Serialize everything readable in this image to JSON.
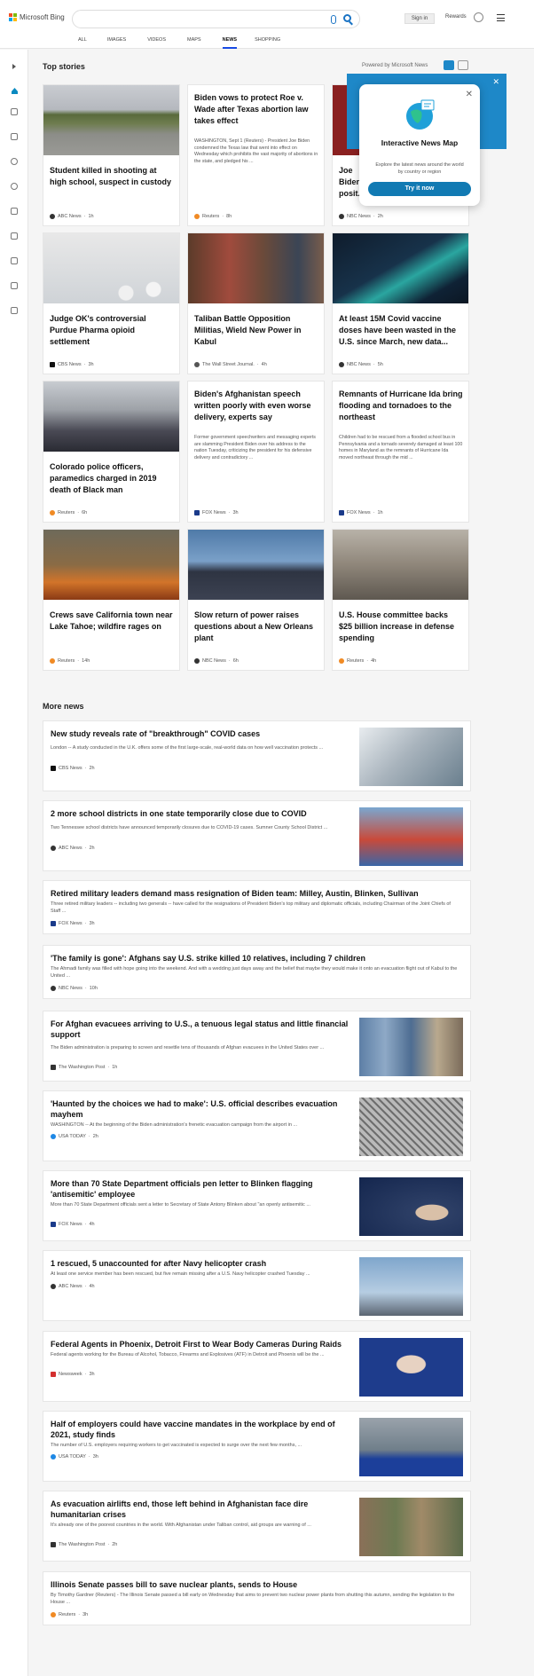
{
  "header": {
    "logo_text": "Microsoft Bing",
    "signin_label": "Sign in",
    "rewards_label": "Rewards"
  },
  "nav": {
    "tabs": [
      {
        "label": "ALL"
      },
      {
        "label": "IMAGES"
      },
      {
        "label": "VIDEOS"
      },
      {
        "label": "MAPS"
      },
      {
        "label": "NEWS"
      },
      {
        "label": "SHOPPING"
      }
    ]
  },
  "top_stories": {
    "title": "Top stories",
    "powered_by": "Powered by Microsoft News",
    "cards": [
      {
        "title": "Student killed in shooting at high school, suspect in custody",
        "source": "ABC News",
        "time": "1h",
        "src_color": "#333"
      },
      {
        "title": "Biden vows to protect Roe v. Wade after Texas abortion law takes effect",
        "snippet": "WASHINGTON, Sept 1 (Reuters) - President Joe Biden condemned the Texas law that went into effect on Wednesday which prohibits the vast majority of abortions in the state, and pledged his ...",
        "source": "Reuters",
        "time": "8h",
        "src_color": "#f08a24"
      },
      {
        "title": "Joe Biden ... posit... ivern...",
        "source": "NBC News",
        "time": "2h",
        "src_color": "#333"
      },
      {
        "title": "Judge OK's controversial Purdue Pharma opioid settlement",
        "source": "CBS News",
        "time": "3h",
        "src_color": "#111"
      },
      {
        "title": "Taliban Battle Opposition Militias, Wield New Power in Kabul",
        "source": "The Wall Street Journal.",
        "time": "4h",
        "src_color": "#555"
      },
      {
        "title": "At least 15M Covid vaccine doses have been wasted in the U.S. since March, new data...",
        "source": "NBC News",
        "time": "5h",
        "src_color": "#333"
      },
      {
        "title": "Colorado police officers, paramedics charged in 2019 death of Black man",
        "source": "Reuters",
        "time": "6h",
        "src_color": "#f08a24"
      },
      {
        "title": "Biden's Afghanistan speech written poorly with even worse delivery, experts say",
        "snippet": "Former government speechwriters and messaging experts are slamming President Biden over his address to the nation Tuesday, criticizing the president for his defensive delivery and contradictory ...",
        "source": "FOX News",
        "time": "3h",
        "src_color": "#1a3a8a"
      },
      {
        "title": "Remnants of Hurricane Ida bring flooding and tornadoes to the northeast",
        "snippet": "Children had to be rescued from a flooded school bus in Pennsylvania and a tornado severely damaged at least 100 homes in Maryland as the remnants of Hurricane Ida moved northeast through the mid ...",
        "source": "FOX News",
        "time": "1h",
        "src_color": "#1a3a8a"
      },
      {
        "title": "Crews save California town near Lake Tahoe; wildfire rages on",
        "source": "Reuters",
        "time": "14h",
        "src_color": "#f08a24"
      },
      {
        "title": "Slow return of power raises questions about a New Orleans plant",
        "source": "NBC News",
        "time": "6h",
        "src_color": "#333"
      },
      {
        "title": "U.S. House committee backs $25 billion increase in defense spending",
        "source": "Reuters",
        "time": "4h",
        "src_color": "#f08a24"
      }
    ]
  },
  "popup": {
    "title": "Interactive News Map",
    "subtitle": "Explore the latest news around the world by country or region",
    "button": "Try it now"
  },
  "more_news": {
    "title": "More news",
    "items": [
      {
        "title": "New study reveals rate of \"breakthrough\" COVID cases",
        "snippet": "London -- A study conducted in the U.K. offers some of the first large-scale, real-world data on how well vaccination protects ...",
        "source": "CBS News",
        "time": "2h",
        "src_color": "#111"
      },
      {
        "title": "2 more school districts in one state temporarily close due to COVID",
        "snippet": "Two Tennessee school districts have announced temporarily closures due to COVID-19 cases. Sumner County School District ...",
        "source": "ABC News",
        "time": "2h",
        "src_color": "#333"
      },
      {
        "title": "Retired military leaders demand mass resignation of Biden team: Milley, Austin, Blinken, Sullivan",
        "snippet": "Three retired military leaders -- including two generals -- have called for the resignations of President Biden's top military and diplomatic officials, including Chairman of the Joint Chiefs of Staff ...",
        "source": "FOX News",
        "time": "3h",
        "src_color": "#1a3a8a"
      },
      {
        "title": "'The family is gone': Afghans say U.S. strike killed 10 relatives, including 7 children",
        "snippet": "The Ahmadi family was filled with hope going into the weekend. And with a wedding just days away and the belief that maybe they would make it onto an evacuation flight out of Kabul to the United ...",
        "source": "NBC News",
        "time": "10h",
        "src_color": "#333"
      },
      {
        "title": "For Afghan evacuees arriving to U.S., a tenuous legal status and little financial support",
        "snippet": "The Biden administration is preparing to screen and resettle tens of thousands of Afghan evacuees in the United States over ...",
        "source": "The Washington Post",
        "time": "1h",
        "src_color": "#333"
      },
      {
        "title": "'Haunted by the choices we had to make': U.S. official describes evacuation mayhem",
        "snippet": "WASHINGTON -- At the beginning of the Biden administration's frenetic evacuation campaign from the airport in ...",
        "source": "USA TODAY",
        "time": "2h",
        "src_color": "#1e88e5"
      },
      {
        "title": "More than 70 State Department officials pen letter to Blinken flagging 'antisemitic' employee",
        "snippet": "More than 70 State Department officials sent a letter to Secretary of State Antony Blinken about \"an openly antisemitic ...",
        "source": "FOX News",
        "time": "4h",
        "src_color": "#1a3a8a"
      },
      {
        "title": "1 rescued, 5 unaccounted for after Navy helicopter crash",
        "snippet": "At least one service member has been rescued, but five remain missing after a U.S. Navy helicopter crashed Tuesday ...",
        "source": "ABC News",
        "time": "4h",
        "src_color": "#333"
      },
      {
        "title": "Federal Agents in Phoenix, Detroit First to Wear Body Cameras During Raids",
        "snippet": "Federal agents working for the Bureau of Alcohol, Tobacco, Firearms and Explosives (ATF) in Detroit and Phoenix will be the ...",
        "source": "Newsweek",
        "time": "3h",
        "src_color": "#d32f2f"
      },
      {
        "title": "Half of employers could have vaccine mandates in the workplace by end of 2021, study finds",
        "snippet": "The number of U.S. employers requiring workers to get vaccinated is expected to surge over the next few months, ...",
        "source": "USA TODAY",
        "time": "3h",
        "src_color": "#1e88e5"
      },
      {
        "title": "As evacuation airlifts end, those left behind in Afghanistan face dire humanitarian crises",
        "snippet": "It's already one of the poorest countries in the world. With Afghanistan under Taliban control, aid groups are warning of ...",
        "source": "The Washington Post",
        "time": "2h",
        "src_color": "#333"
      },
      {
        "title": "Illinois Senate passes bill to save nuclear plants, sends to House",
        "snippet": "By Timothy Gardner (Reuters) - The Illinois Senate passed a bill early on Wednesday that aims to prevent two nuclear power plants from shutting this autumn, sending the legislation to the House ...",
        "source": "Reuters",
        "time": "3h",
        "src_color": "#f08a24"
      }
    ]
  },
  "colors": {
    "accent": "#174ae4",
    "popup_button": "#117ab3",
    "map_banner": "#1e88c8"
  }
}
